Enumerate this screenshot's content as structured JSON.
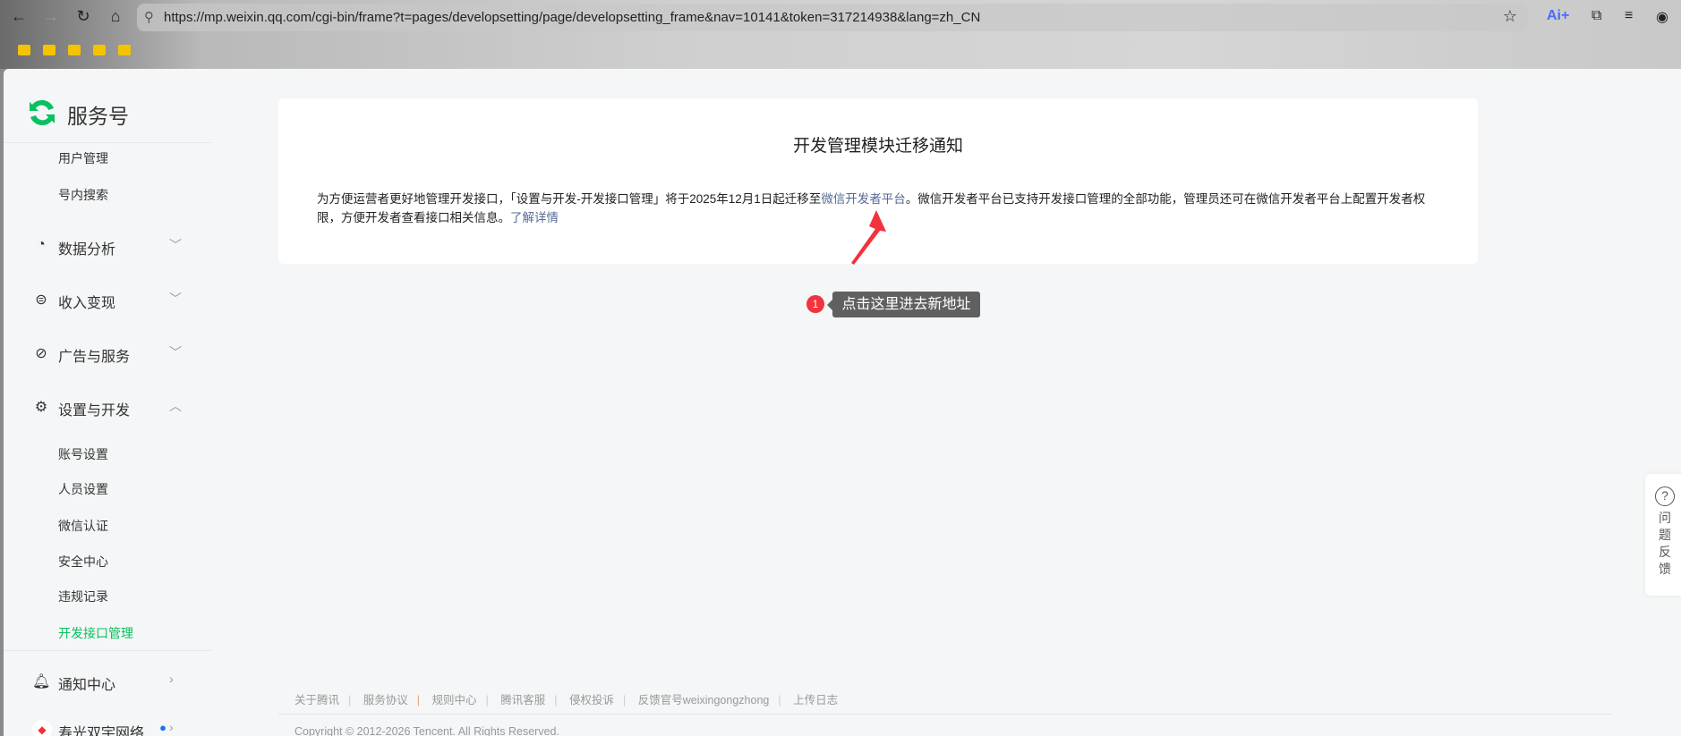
{
  "browser": {
    "url": "https://mp.weixin.qq.com/cgi-bin/frame?t=pages/developsetting/page/developsetting_frame&nav=10141&token=317214938&lang=zh_CN",
    "ai_label": "Ai+",
    "bookmark_folders": 5
  },
  "sidebar": {
    "brand": "服务号",
    "top_items": [
      "用户管理",
      "号内搜索"
    ],
    "groups": [
      {
        "label": "数据分析",
        "icon": "pie-chart-icon",
        "state": "collapsed"
      },
      {
        "label": "收入变现",
        "icon": "yen-icon",
        "state": "collapsed"
      },
      {
        "label": "广告与服务",
        "icon": "compass-icon",
        "state": "collapsed"
      },
      {
        "label": "设置与开发",
        "icon": "gear-icon",
        "state": "expanded"
      }
    ],
    "settings_items": [
      "账号设置",
      "人员设置",
      "微信认证",
      "安全中心",
      "违规记录",
      "开发接口管理"
    ],
    "active_item": "开发接口管理",
    "notify": "通知中心",
    "account": "寿光双宇网络..."
  },
  "notice": {
    "title": "开发管理模块迁移通知",
    "text_before": "为方便运营者更好地管理开发接口，「设置与开发-开发接口管理」将于2025年12月1日起迁移至",
    "link1": "微信开发者平台",
    "text_after": "。微信开发者平台已支持开发接口管理的全部功能，管理员还可在微信开发者平台上配置开发者权限，方便开发者查看接口相关信息。",
    "link2": "了解详情"
  },
  "annotation": {
    "number": "1",
    "text": "点击这里进去新地址",
    "color": "#f2323c"
  },
  "feedback": {
    "label": "问题反馈"
  },
  "footer": {
    "links": [
      "关于腾讯",
      "服务协议",
      "规则中心",
      "腾讯客服",
      "侵权投诉",
      "反馈官号weixingongzhong",
      "上传日志"
    ],
    "copyright": "Copyright © 2012-2026 Tencent. All Rights Reserved."
  },
  "colors": {
    "accent": "#07c160",
    "link": "#576b95"
  }
}
